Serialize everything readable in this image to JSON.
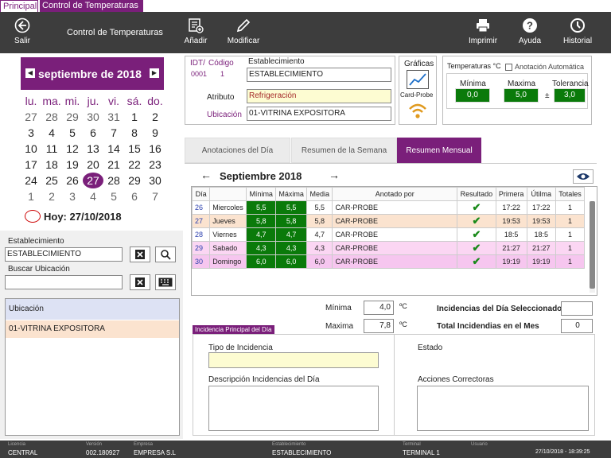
{
  "top_tabs": [
    "Principal",
    "Control de Temperaturas"
  ],
  "toolbar": {
    "salir": "Salir",
    "title": "Control de Temperaturas",
    "anadir": "Añadir",
    "modificar": "Modificar",
    "imprimir": "Imprimir",
    "ayuda": "Ayuda",
    "historial": "Historial"
  },
  "calendar": {
    "month": "septiembre de 2018",
    "days": [
      "lu.",
      "ma.",
      "mi.",
      "ju.",
      "vi.",
      "sá.",
      "do."
    ],
    "weeks": [
      [
        "27",
        "28",
        "29",
        "30",
        "31",
        "1",
        "2"
      ],
      [
        "3",
        "4",
        "5",
        "6",
        "7",
        "8",
        "9"
      ],
      [
        "10",
        "11",
        "12",
        "13",
        "14",
        "15",
        "16"
      ],
      [
        "17",
        "18",
        "19",
        "20",
        "21",
        "22",
        "23"
      ],
      [
        "24",
        "25",
        "26",
        "27",
        "28",
        "29",
        "30"
      ],
      [
        "1",
        "2",
        "3",
        "4",
        "5",
        "6",
        "7"
      ]
    ],
    "today": "Hoy: 27/10/2018"
  },
  "left": {
    "establecimiento_label": "Establecimiento",
    "establecimiento_value": "ESTABLECIMIENTO",
    "buscar_label": "Buscar Ubicación",
    "buscar_value": "",
    "list_header": "Ubicación",
    "list_items": [
      "01-VITRINA EXPOSITORA"
    ]
  },
  "header": {
    "idt_label": "IDT/",
    "idt_value": "0001",
    "codigo_label": "Código",
    "codigo_value": "1",
    "est_label": "Establecimiento",
    "est_value": "ESTABLECIMIENTO",
    "atributo_label": "Atributo",
    "atributo_value": "Refrigeración",
    "ubicacion_label": "Ubicación",
    "ubicacion_value": "01-VITRINA EXPOSITORA",
    "graficas": "Gráficas",
    "cardprobe": "Card-Probe"
  },
  "temps": {
    "title": "Temperaturas °C",
    "auto_label": "Anotación Automática",
    "min_label": "Mínima",
    "min_value": "0,0",
    "max_label": "Maxima",
    "max_value": "5,0",
    "tol_label": "Tolerancia",
    "tol_value": "3,0",
    "pm": "±"
  },
  "tabs": [
    "Anotaciones del Día",
    "Resumen de la Semana",
    "Resumen Mensual"
  ],
  "month_nav": {
    "title": "Septiembre 2018",
    "prev": "←",
    "next": "→"
  },
  "grid": {
    "headers": [
      "Día",
      "",
      "Mínima",
      "Máxima",
      "Media",
      "Anotado por",
      "Resultado",
      "Primera",
      "Útilma",
      "Totales"
    ],
    "rows": [
      {
        "dia": "26",
        "dname": "Miercoles",
        "min": "5,5",
        "max": "5,5",
        "media": "5,5",
        "por": "CAR-PROBE",
        "primera": "17:22",
        "ultima": "17:22",
        "total": "1"
      },
      {
        "dia": "27",
        "dname": "Jueves",
        "min": "5,8",
        "max": "5,8",
        "media": "5,8",
        "por": "CAR-PROBE",
        "primera": "19:53",
        "ultima": "19:53",
        "total": "1"
      },
      {
        "dia": "28",
        "dname": "Viernes",
        "min": "4,7",
        "max": "4,7",
        "media": "4,7",
        "por": "CAR-PROBE",
        "primera": "18:5",
        "ultima": "18:5",
        "total": "1"
      },
      {
        "dia": "29",
        "dname": "Sabado",
        "min": "4,3",
        "max": "4,3",
        "media": "4,3",
        "por": "CAR-PROBE",
        "primera": "21:27",
        "ultima": "21:27",
        "total": "1"
      },
      {
        "dia": "30",
        "dname": "Domingo",
        "min": "6,0",
        "max": "6,0",
        "media": "6,0",
        "por": "CAR-PROBE",
        "primera": "19:19",
        "ultima": "19:19",
        "total": "1"
      }
    ]
  },
  "summary": {
    "min_label": "Mínima",
    "min_value": "4,0",
    "max_label": "Maxima",
    "max_value": "7,8",
    "unit": "ºC",
    "inc_dia_label": "Incidencias del Día Seleccionado",
    "inc_dia_value": "",
    "inc_mes_label": "Total Incidendias en el Mes",
    "inc_mes_value": "0"
  },
  "incidencia": {
    "title": "Incidencia Principal del Día",
    "tipo_label": "Tipo de Incidencia",
    "estado_label": "Estado",
    "desc_label": "Descripción Incidencias del Día",
    "acciones_label": "Acciones Correctoras"
  },
  "status": {
    "licencia_l": "Licencia",
    "licencia": "CENTRAL",
    "version_l": "Versión",
    "version": "002.180927",
    "empresa_l": "Empresa",
    "empresa": "EMPRESA S.L",
    "est_l": "Establecimiento",
    "est": "ESTABLECIMIENTO",
    "terminal_l": "Terminal",
    "terminal": "TERMINAL 1",
    "usuario_l": "Usuario",
    "fecha": "27/10/2018 - 18:39:25"
  }
}
